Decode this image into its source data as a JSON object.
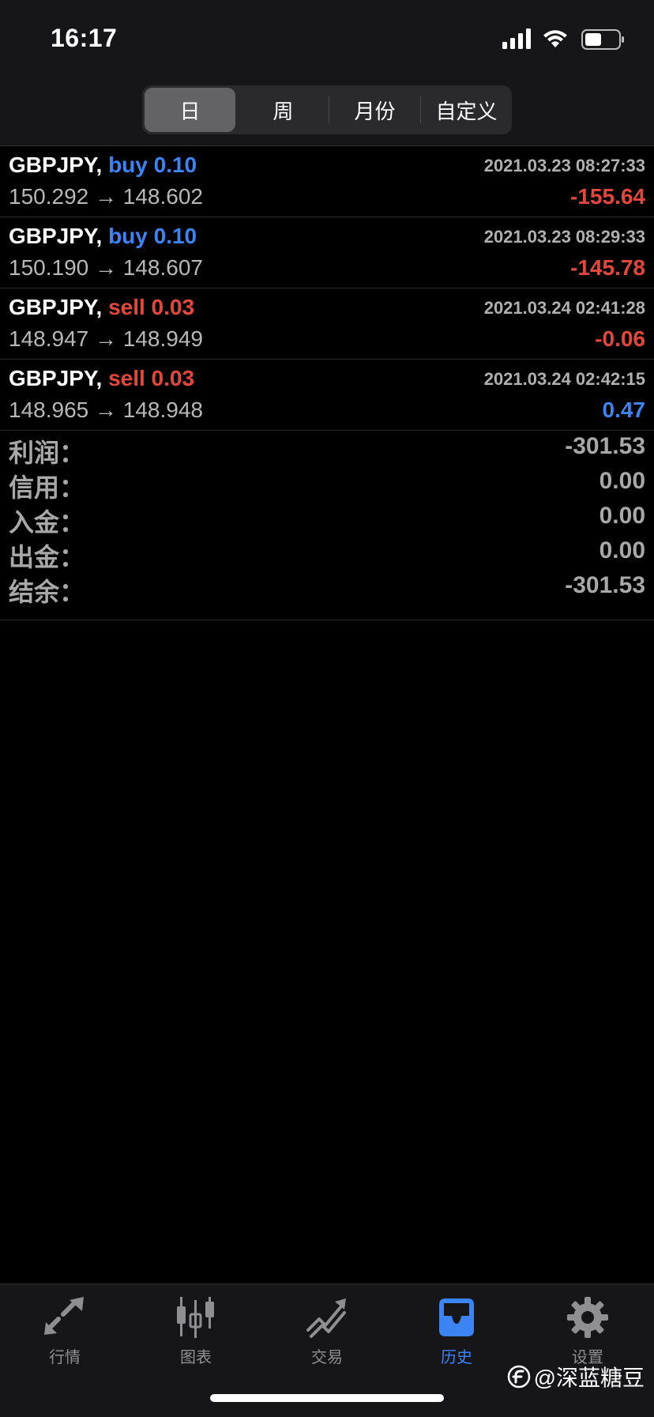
{
  "status_bar": {
    "time": "16:17",
    "icons": [
      "signal-icon",
      "wifi-icon",
      "battery-icon"
    ]
  },
  "period_tabs": [
    {
      "label": "日",
      "active": true
    },
    {
      "label": "周",
      "active": false
    },
    {
      "label": "月份",
      "active": false
    },
    {
      "label": "自定义",
      "active": false
    }
  ],
  "trades": [
    {
      "symbol": "GBPJPY,",
      "side": "buy",
      "volume": "0.10",
      "time": "2021.03.23 08:27:33",
      "open_price": "150.292",
      "arrow": "→",
      "close_price": "148.602",
      "profit": "-155.64"
    },
    {
      "symbol": "GBPJPY,",
      "side": "buy",
      "volume": "0.10",
      "time": "2021.03.23 08:29:33",
      "open_price": "150.190",
      "arrow": "→",
      "close_price": "148.607",
      "profit": "-145.78"
    },
    {
      "symbol": "GBPJPY,",
      "side": "sell",
      "volume": "0.03",
      "time": "2021.03.24 02:41:28",
      "open_price": "148.947",
      "arrow": "→",
      "close_price": "148.949",
      "profit": "-0.06"
    },
    {
      "symbol": "GBPJPY,",
      "side": "sell",
      "volume": "0.03",
      "time": "2021.03.24 02:42:15",
      "open_price": "148.965",
      "arrow": "→",
      "close_price": "148.948",
      "profit": "0.47"
    }
  ],
  "summary": [
    {
      "label": "利润：",
      "value": "-301.53"
    },
    {
      "label": "信用：",
      "value": "0.00"
    },
    {
      "label": "入金：",
      "value": "0.00"
    },
    {
      "label": "出金：",
      "value": "0.00"
    },
    {
      "label": "结余：",
      "value": "-301.53"
    }
  ],
  "bottom_tabs": [
    {
      "label": "行情",
      "icon": "quotes-arrows-icon",
      "active": false
    },
    {
      "label": "图表",
      "icon": "candlestick-chart-icon",
      "active": false
    },
    {
      "label": "交易",
      "icon": "trade-trend-icon",
      "active": false
    },
    {
      "label": "历史",
      "icon": "history-inbox-icon",
      "active": true
    },
    {
      "label": "设置",
      "icon": "gear-icon",
      "active": false
    }
  ],
  "watermark": {
    "text": "@深蓝糖豆"
  },
  "colors": {
    "buy": "#3c84f4",
    "sell": "#e3473c",
    "active_tab": "#3c84f4",
    "inactive_tab": "#8e8e93"
  }
}
